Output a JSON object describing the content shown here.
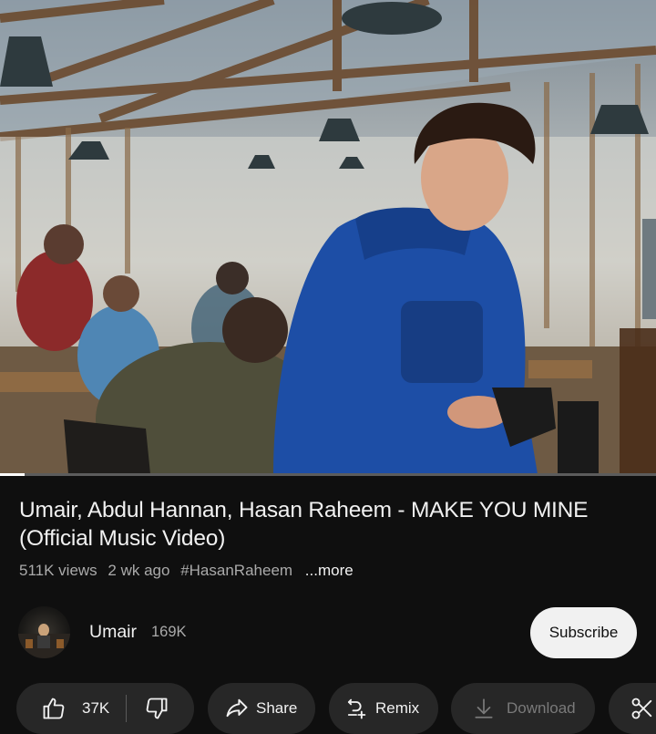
{
  "video": {
    "progress_fraction": 0.037
  },
  "title": "Umair, Abdul Hannan, Hasan Raheem - MAKE YOU MINE (Official Music Video)",
  "meta": {
    "views": "511K views",
    "age": "2 wk ago",
    "hashtag": "#HasanRaheem",
    "more": "...more"
  },
  "channel": {
    "name": "Umair",
    "subscribers": "169K",
    "subscribe_label": "Subscribe"
  },
  "actions": {
    "like_count": "37K",
    "share_label": "Share",
    "remix_label": "Remix",
    "download_label": "Download"
  },
  "icons": {
    "like": "thumbs-up-icon",
    "dislike": "thumbs-down-icon",
    "share": "share-arrow-icon",
    "remix": "remix-icon",
    "download": "download-icon",
    "clip": "scissors-icon"
  },
  "colors": {
    "background": "#0f0f0f",
    "pill": "#272727",
    "text_primary": "#f1f1f1",
    "text_secondary": "#aaaaaa",
    "subscribe_bg": "#f1f1f1",
    "disabled": "#7a7a7a"
  }
}
